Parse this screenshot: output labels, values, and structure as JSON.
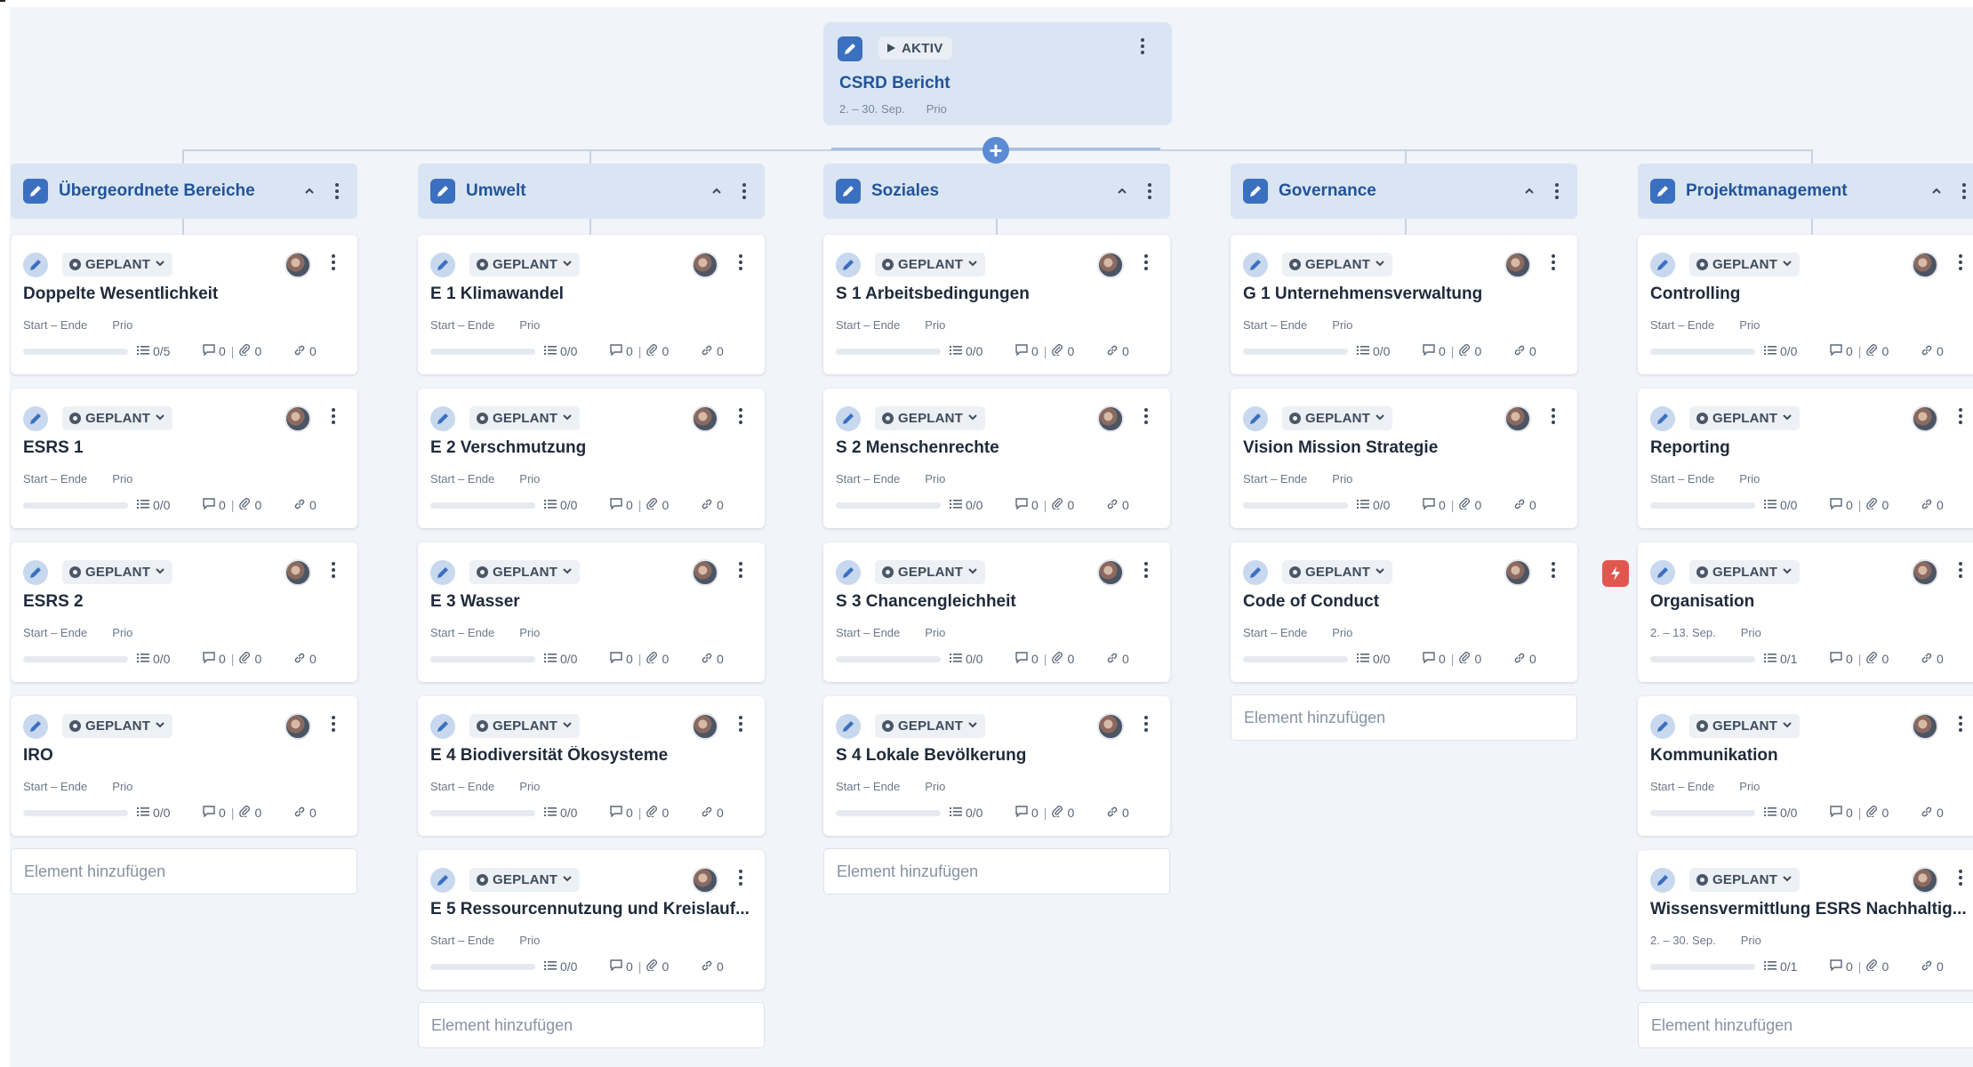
{
  "root": {
    "status": "AKTIV",
    "title": "CSRD Bericht",
    "dates": "2. – 30. Sep.",
    "prio": "Prio",
    "add_symbol": "+"
  },
  "status_label": "GEPLANT",
  "add_element_label": "Element hinzufügen",
  "colors": {
    "accent": "#3b6fc0",
    "header_bg": "#d9e5f3",
    "title_blue": "#22549a",
    "flash_red": "#e0574f",
    "canvas_bg": "#f1f4f8"
  },
  "columns": [
    {
      "title": "Übergeordnete Bereiche",
      "cards": [
        {
          "title": "Doppelte Wesentlichkeit",
          "dates": "Start – Ende",
          "prio": "Prio",
          "subtasks": "0/5",
          "comments": "0",
          "attachments": "0",
          "links": "0"
        },
        {
          "title": "ESRS 1",
          "dates": "Start – Ende",
          "prio": "Prio",
          "subtasks": "0/0",
          "comments": "0",
          "attachments": "0",
          "links": "0"
        },
        {
          "title": "ESRS 2",
          "dates": "Start – Ende",
          "prio": "Prio",
          "subtasks": "0/0",
          "comments": "0",
          "attachments": "0",
          "links": "0"
        },
        {
          "title": "IRO",
          "dates": "Start – Ende",
          "prio": "Prio",
          "subtasks": "0/0",
          "comments": "0",
          "attachments": "0",
          "links": "0"
        }
      ]
    },
    {
      "title": "Umwelt",
      "cards": [
        {
          "title": "E 1 Klimawandel",
          "dates": "Start – Ende",
          "prio": "Prio",
          "subtasks": "0/0",
          "comments": "0",
          "attachments": "0",
          "links": "0"
        },
        {
          "title": "E 2 Verschmutzung",
          "dates": "Start – Ende",
          "prio": "Prio",
          "subtasks": "0/0",
          "comments": "0",
          "attachments": "0",
          "links": "0"
        },
        {
          "title": "E 3 Wasser",
          "dates": "Start – Ende",
          "prio": "Prio",
          "subtasks": "0/0",
          "comments": "0",
          "attachments": "0",
          "links": "0"
        },
        {
          "title": "E 4 Biodiversität Ökosysteme",
          "dates": "Start – Ende",
          "prio": "Prio",
          "subtasks": "0/0",
          "comments": "0",
          "attachments": "0",
          "links": "0"
        },
        {
          "title": "E 5 Ressourcennutzung und Kreislauf...",
          "dates": "Start – Ende",
          "prio": "Prio",
          "subtasks": "0/0",
          "comments": "0",
          "attachments": "0",
          "links": "0"
        }
      ]
    },
    {
      "title": "Soziales",
      "cards": [
        {
          "title": "S 1 Arbeitsbedingungen",
          "dates": "Start – Ende",
          "prio": "Prio",
          "subtasks": "0/0",
          "comments": "0",
          "attachments": "0",
          "links": "0"
        },
        {
          "title": "S 2 Menschenrechte",
          "dates": "Start – Ende",
          "prio": "Prio",
          "subtasks": "0/0",
          "comments": "0",
          "attachments": "0",
          "links": "0"
        },
        {
          "title": "S 3 Chancengleichheit",
          "dates": "Start – Ende",
          "prio": "Prio",
          "subtasks": "0/0",
          "comments": "0",
          "attachments": "0",
          "links": "0"
        },
        {
          "title": "S 4 Lokale Bevölkerung",
          "dates": "Start – Ende",
          "prio": "Prio",
          "subtasks": "0/0",
          "comments": "0",
          "attachments": "0",
          "links": "0"
        }
      ]
    },
    {
      "title": "Governance",
      "cards": [
        {
          "title": "G 1 Unternehmensverwaltung",
          "dates": "Start – Ende",
          "prio": "Prio",
          "subtasks": "0/0",
          "comments": "0",
          "attachments": "0",
          "links": "0"
        },
        {
          "title": "Vision Mission Strategie",
          "dates": "Start – Ende",
          "prio": "Prio",
          "subtasks": "0/0",
          "comments": "0",
          "attachments": "0",
          "links": "0"
        },
        {
          "title": "Code of Conduct",
          "dates": "Start – Ende",
          "prio": "Prio",
          "subtasks": "0/0",
          "comments": "0",
          "attachments": "0",
          "links": "0"
        }
      ]
    },
    {
      "title": "Projektmanagement",
      "cards": [
        {
          "title": "Controlling",
          "dates": "Start – Ende",
          "prio": "Prio",
          "subtasks": "0/0",
          "comments": "0",
          "attachments": "0",
          "links": "0"
        },
        {
          "title": "Reporting",
          "dates": "Start – Ende",
          "prio": "Prio",
          "subtasks": "0/0",
          "comments": "0",
          "attachments": "0",
          "links": "0"
        },
        {
          "title": "Organisation",
          "dates": "2. – 13. Sep.",
          "prio": "Prio",
          "subtasks": "0/1",
          "comments": "0",
          "attachments": "0",
          "links": "0",
          "flagged": true
        },
        {
          "title": "Kommunikation",
          "dates": "Start – Ende",
          "prio": "Prio",
          "subtasks": "0/0",
          "comments": "0",
          "attachments": "0",
          "links": "0"
        },
        {
          "title": "Wissensvermittlung ESRS Nachhaltig...",
          "dates": "2. – 30. Sep.",
          "prio": "Prio",
          "subtasks": "0/1",
          "comments": "0",
          "attachments": "0",
          "links": "0"
        }
      ]
    }
  ]
}
